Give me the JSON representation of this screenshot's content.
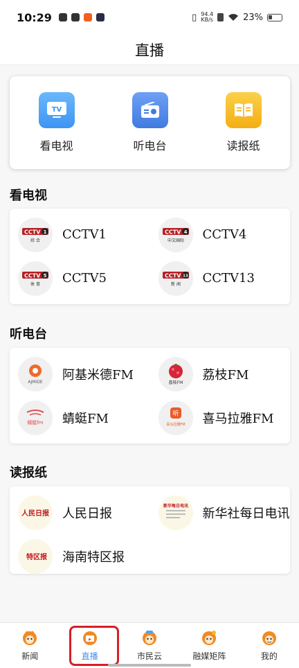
{
  "status_bar": {
    "time": "10:29",
    "net_speed_value": "94.4",
    "net_speed_unit": "KB/s",
    "battery": "23%"
  },
  "header": {
    "title": "直播"
  },
  "quick_entries": [
    {
      "label": "看电视",
      "icon": "tv-icon",
      "color": "#4aa3f7"
    },
    {
      "label": "听电台",
      "icon": "radio-icon",
      "color": "#4a86e8"
    },
    {
      "label": "读报纸",
      "icon": "newspaper-icon",
      "color": "#f5b921"
    }
  ],
  "sections": {
    "tv": {
      "title": "看电视",
      "items": [
        "CCTV1",
        "CCTV4",
        "CCTV5",
        "CCTV13"
      ],
      "logo_sub": [
        "综 合",
        "中文国际",
        "体 育",
        "新 闻"
      ]
    },
    "radio": {
      "title": "听电台",
      "items": [
        "阿基米德FM",
        "荔枝FM",
        "蜻蜓FM",
        "喜马拉雅FM"
      ],
      "logo_text": [
        "AJMIDE",
        "荔枝FM",
        "蜻蜓fm",
        "喜马拉雅FM"
      ]
    },
    "paper": {
      "title": "读报纸",
      "items": [
        "人民日报",
        "新华社每日电讯",
        "海南特区报"
      ],
      "logo_text": [
        "人民日报",
        "新华每日电讯",
        "特区报"
      ]
    }
  },
  "bottom_nav": [
    {
      "label": "新闻",
      "active": false
    },
    {
      "label": "直播",
      "active": true
    },
    {
      "label": "市民云",
      "active": false
    },
    {
      "label": "融媒矩阵",
      "active": false
    },
    {
      "label": "我的",
      "active": false
    }
  ],
  "colors": {
    "accent": "#4a8fe8",
    "highlight": "#d81e26",
    "brand_orange": "#f08a24"
  }
}
